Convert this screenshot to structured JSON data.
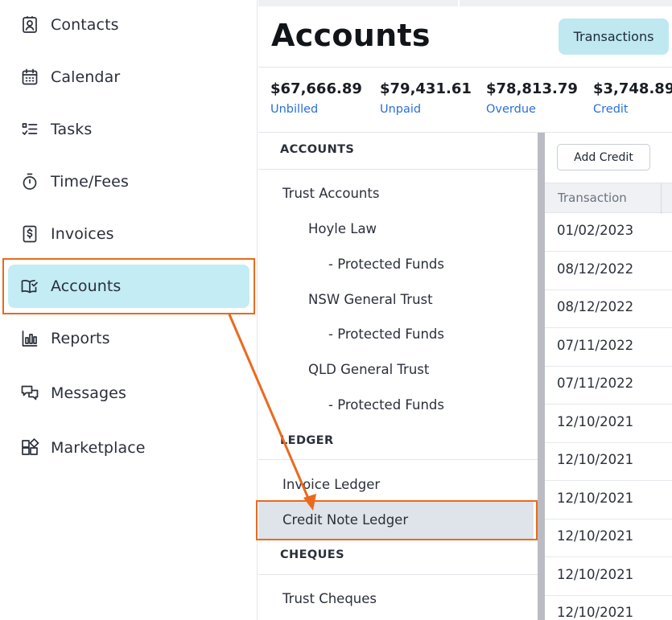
{
  "nav": {
    "items": [
      {
        "label": "Contacts",
        "icon": "contacts-icon"
      },
      {
        "label": "Calendar",
        "icon": "calendar-icon"
      },
      {
        "label": "Tasks",
        "icon": "tasks-icon"
      },
      {
        "label": "Time/Fees",
        "icon": "stopwatch-icon"
      },
      {
        "label": "Invoices",
        "icon": "invoice-dollar-icon"
      },
      {
        "label": "Accounts",
        "icon": "book-check-icon",
        "active": true
      },
      {
        "label": "Reports",
        "icon": "bar-chart-icon"
      },
      {
        "label": "Messages",
        "icon": "messages-icon"
      },
      {
        "label": "Marketplace",
        "icon": "marketplace-grid-icon"
      }
    ]
  },
  "header": {
    "title": "Accounts",
    "transactions_button": "Transactions"
  },
  "summary": [
    {
      "amount": "$67,666.89",
      "caption": "Unbilled"
    },
    {
      "amount": "$79,431.61",
      "caption": "Unpaid"
    },
    {
      "amount": "$78,813.79",
      "caption": "Overdue"
    },
    {
      "amount": "$3,748.89",
      "caption": "Credit"
    }
  ],
  "tree": {
    "accounts_heading": "ACCOUNTS",
    "trust_accounts": "Trust Accounts",
    "hoyle_law": "Hoyle Law",
    "protected_funds_1": "- Protected Funds",
    "nsw_general_trust": "NSW General Trust",
    "protected_funds_2": "- Protected Funds",
    "qld_general_trust": "QLD General Trust",
    "protected_funds_3": "- Protected Funds",
    "ledger_heading": "LEDGER",
    "invoice_ledger": "Invoice Ledger",
    "credit_note_ledger": "Credit Note Ledger",
    "cheques_heading": "CHEQUES",
    "trust_cheques": "Trust Cheques"
  },
  "table": {
    "add_credit_button": "Add Credit",
    "column_transaction": "Transaction",
    "rows": [
      "01/02/2023",
      "08/12/2022",
      "08/12/2022",
      "07/11/2022",
      "07/11/2022",
      "12/10/2021",
      "12/10/2021",
      "12/10/2021",
      "12/10/2021",
      "12/10/2021",
      "12/10/2021"
    ]
  },
  "colors": {
    "accent_active": "#c4ecf4",
    "transactions_button": "#bfe8f1",
    "link_blue": "#2a6fd6",
    "annotation_orange": "#ea6a1d",
    "selected_row": "#dfe3ea"
  }
}
